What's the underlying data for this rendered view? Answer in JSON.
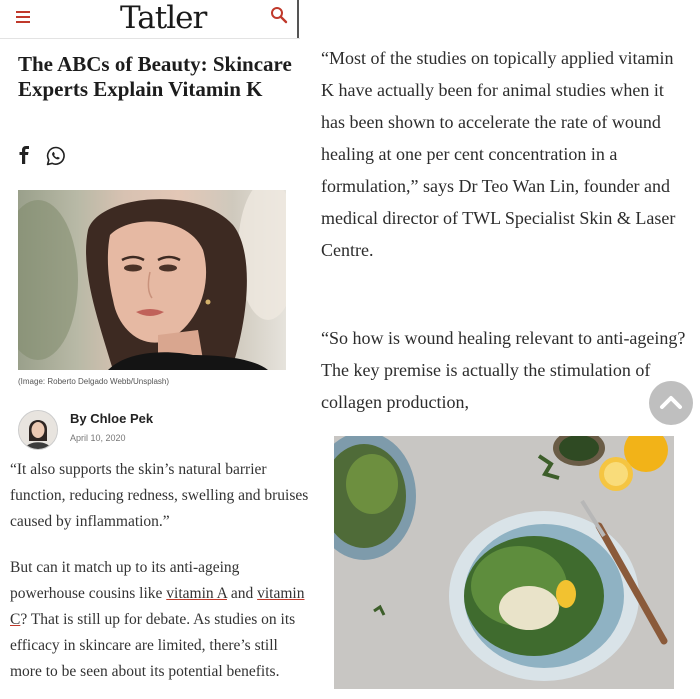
{
  "header": {
    "logo_text": "Tatler",
    "menu_icon": "hamburger-menu-icon",
    "search_icon": "search-icon",
    "accent_color": "#c0392b"
  },
  "article": {
    "title": "The ABCs of Beauty: Skincare Experts Explain Vitamin K",
    "share_icons": [
      "facebook-icon",
      "whatsapp-icon"
    ],
    "image_caption": "(Image: Roberto Delgado Webb/Unsplash)",
    "author": "By Chloe Pek",
    "date": "April 10, 2020",
    "body_left": {
      "p1": "“It also supports the skin’s natural barrier function, reducing redness, swelling and bruises caused by inflammation.”",
      "p2_before": "But can it match up to its anti-ageing powerhouse cousins like ",
      "link1": "vitamin A",
      "p2_mid": " and ",
      "link2": "vitamin C",
      "p2_after": "? That is still up for debate. As studies on its efficacy in skincare are limited, there’s still more to be seen about its potential benefits."
    },
    "body_right": {
      "p1": "“Most of the studies on topically applied vitamin K have actually been for animal studies when it has been shown to accelerate the rate of wound healing at one per cent concentration in a formulation,” says Dr Teo Wan Lin, founder and medical director of TWL Specialist Skin & Laser Centre.",
      "p2": "“So how is wound healing relevant to anti-ageing? The key premise is actually the stimulation of collagen production,"
    },
    "scroll_top_icon": "chevron-up-icon"
  }
}
